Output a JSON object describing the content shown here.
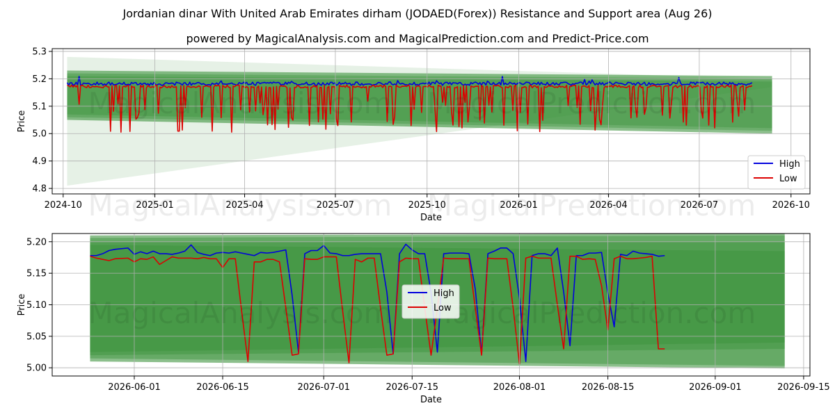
{
  "title": "Jordanian dinar With United Arab Emirates dirham (JODAED(Forex)) Resistance and Support area (Aug 26)",
  "subtitle": "powered by MagicalAnalysis.com and MagicalPrediction.com and Predict-Price.com",
  "watermarks": [
    "MagicalAnalysis.com",
    "MagicalPrediction.com"
  ],
  "colors": {
    "high": "#0000dd",
    "low": "#dd0000",
    "band": "#2e8b2e",
    "grid": "#b0b0b0"
  },
  "chart_data": [
    {
      "type": "line",
      "xlabel": "Date",
      "ylabel": "Price",
      "x_ticks": [
        "2024-10",
        "2025-01",
        "2025-04",
        "2025-07",
        "2025-10",
        "2026-01",
        "2026-04",
        "2026-07",
        "2026-10"
      ],
      "y_ticks": [
        "4.8",
        "4.9",
        "5.0",
        "5.1",
        "5.2",
        "5.3"
      ],
      "x_range": [
        "2024-09-20",
        "2026-10-20"
      ],
      "ylim": [
        4.78,
        5.31
      ],
      "x_start": "2024-10-05",
      "x_end": "2026-08-24",
      "band_end": "2026-09-12",
      "bands": [
        {
          "start": [
            4.81,
            5.28
          ],
          "end": [
            5.17,
            5.2
          ],
          "opacity": 0.12
        },
        {
          "start": [
            5.05,
            5.23
          ],
          "end": [
            5.0,
            5.21
          ],
          "opacity": 0.55
        },
        {
          "start": [
            5.06,
            5.22
          ],
          "end": [
            5.01,
            5.2
          ],
          "opacity": 0.35
        },
        {
          "start": [
            5.07,
            5.21
          ],
          "end": [
            5.02,
            5.19
          ],
          "opacity": 0.3
        }
      ],
      "series": [
        {
          "name": "High",
          "base": 5.182,
          "amp": 0.006,
          "spike": 5.205
        },
        {
          "name": "Low",
          "base": 5.172,
          "dip_min": 5.005,
          "dip_max": 5.12,
          "spike": 5.212
        }
      ],
      "legend": {
        "position": "lower-right",
        "entries": [
          "High",
          "Low"
        ]
      },
      "grid": true
    },
    {
      "type": "line",
      "xlabel": "Date",
      "ylabel": "Price",
      "x_ticks": [
        "2026-06-01",
        "2026-06-15",
        "2026-07-01",
        "2026-07-15",
        "2026-08-01",
        "2026-08-15",
        "2026-09-01",
        "2026-09-15"
      ],
      "y_ticks": [
        "5.00",
        "5.05",
        "5.10",
        "5.15",
        "5.20"
      ],
      "x_range": [
        "2026-05-19",
        "2026-09-16"
      ],
      "ylim": [
        4.987,
        5.213
      ],
      "band_start": "2026-05-25",
      "band_end": "2026-09-12",
      "bands": [
        {
          "start": [
            5.01,
            5.21
          ],
          "end": [
            4.999,
            5.213
          ],
          "opacity": 0.55
        },
        {
          "start": [
            5.015,
            5.206
          ],
          "end": [
            5.003,
            5.21
          ],
          "opacity": 0.4
        },
        {
          "start": [
            5.02,
            5.2
          ],
          "end": [
            5.03,
            5.2
          ],
          "opacity": 0.35
        },
        {
          "start": [
            5.025,
            5.195
          ],
          "end": [
            5.04,
            5.185
          ],
          "opacity": 0.3
        }
      ],
      "series": [
        {
          "name": "High",
          "x": [
            "2026-05-25",
            "2026-05-26",
            "2026-05-27",
            "2026-05-28",
            "2026-05-29",
            "2026-05-31",
            "2026-06-01",
            "2026-06-02",
            "2026-06-03",
            "2026-06-04",
            "2026-06-05",
            "2026-06-06",
            "2026-06-07",
            "2026-06-08",
            "2026-06-09",
            "2026-06-10",
            "2026-06-11",
            "2026-06-12",
            "2026-06-13",
            "2026-06-14",
            "2026-06-15",
            "2026-06-16",
            "2026-06-17",
            "2026-06-18",
            "2026-06-19",
            "2026-06-20",
            "2026-06-21",
            "2026-06-22",
            "2026-06-23",
            "2026-06-24",
            "2026-06-25",
            "2026-06-26",
            "2026-06-27",
            "2026-06-28",
            "2026-06-29",
            "2026-06-30",
            "2026-07-01",
            "2026-07-02",
            "2026-07-03",
            "2026-07-04",
            "2026-07-05",
            "2026-07-06",
            "2026-07-07",
            "2026-07-08",
            "2026-07-09",
            "2026-07-10",
            "2026-07-11",
            "2026-07-12",
            "2026-07-13",
            "2026-07-14",
            "2026-07-15",
            "2026-07-16",
            "2026-07-17",
            "2026-07-18",
            "2026-07-19",
            "2026-07-20",
            "2026-07-21",
            "2026-07-22",
            "2026-07-23",
            "2026-07-24",
            "2026-07-25",
            "2026-07-26",
            "2026-07-27",
            "2026-07-28",
            "2026-07-29",
            "2026-07-30",
            "2026-07-31",
            "2026-08-01",
            "2026-08-02",
            "2026-08-03",
            "2026-08-04",
            "2026-08-05",
            "2026-08-06",
            "2026-08-07",
            "2026-08-08",
            "2026-08-09",
            "2026-08-10",
            "2026-08-11",
            "2026-08-12",
            "2026-08-13",
            "2026-08-14",
            "2026-08-15",
            "2026-08-16",
            "2026-08-17",
            "2026-08-18",
            "2026-08-19",
            "2026-08-20",
            "2026-08-21",
            "2026-08-22",
            "2026-08-23",
            "2026-08-24"
          ],
          "values": [
            5.178,
            5.178,
            5.181,
            5.186,
            5.188,
            5.19,
            5.18,
            5.184,
            5.181,
            5.185,
            5.181,
            5.181,
            5.18,
            5.182,
            5.185,
            5.195,
            5.183,
            5.18,
            5.178,
            5.182,
            5.183,
            5.182,
            5.184,
            5.182,
            5.18,
            5.178,
            5.183,
            5.182,
            5.183,
            5.185,
            5.187,
            5.115,
            5.025,
            5.181,
            5.186,
            5.186,
            5.194,
            5.182,
            5.181,
            5.178,
            5.178,
            5.18,
            5.181,
            5.181,
            5.181,
            5.181,
            5.12,
            5.022,
            5.181,
            5.196,
            5.187,
            5.181,
            5.181,
            5.119,
            5.025,
            5.181,
            5.182,
            5.182,
            5.182,
            5.181,
            5.125,
            5.022,
            5.181,
            5.185,
            5.19,
            5.19,
            5.181,
            5.11,
            5.01,
            5.178,
            5.181,
            5.181,
            5.178,
            5.19,
            5.12,
            5.035,
            5.178,
            5.178,
            5.182,
            5.182,
            5.183,
            5.118,
            5.065,
            5.18,
            5.178,
            5.185,
            5.182,
            5.181,
            5.18,
            5.177,
            5.178
          ],
          "color": "#0000dd"
        },
        {
          "name": "Low",
          "x": [
            "2026-05-25",
            "2026-05-26",
            "2026-05-27",
            "2026-05-28",
            "2026-05-29",
            "2026-05-31",
            "2026-06-01",
            "2026-06-02",
            "2026-06-03",
            "2026-06-04",
            "2026-06-05",
            "2026-06-06",
            "2026-06-07",
            "2026-06-08",
            "2026-06-09",
            "2026-06-10",
            "2026-06-11",
            "2026-06-12",
            "2026-06-13",
            "2026-06-14",
            "2026-06-15",
            "2026-06-16",
            "2026-06-17",
            "2026-06-18",
            "2026-06-19",
            "2026-06-20",
            "2026-06-21",
            "2026-06-22",
            "2026-06-23",
            "2026-06-24",
            "2026-06-25",
            "2026-06-26",
            "2026-06-27",
            "2026-06-28",
            "2026-06-29",
            "2026-06-30",
            "2026-07-01",
            "2026-07-02",
            "2026-07-03",
            "2026-07-04",
            "2026-07-05",
            "2026-07-06",
            "2026-07-07",
            "2026-07-08",
            "2026-07-09",
            "2026-07-10",
            "2026-07-11",
            "2026-07-12",
            "2026-07-13",
            "2026-07-14",
            "2026-07-15",
            "2026-07-16",
            "2026-07-17",
            "2026-07-18",
            "2026-07-19",
            "2026-07-20",
            "2026-07-21",
            "2026-07-22",
            "2026-07-23",
            "2026-07-24",
            "2026-07-25",
            "2026-07-26",
            "2026-07-27",
            "2026-07-28",
            "2026-07-29",
            "2026-07-30",
            "2026-07-31",
            "2026-08-01",
            "2026-08-02",
            "2026-08-03",
            "2026-08-04",
            "2026-08-05",
            "2026-08-06",
            "2026-08-07",
            "2026-08-08",
            "2026-08-09",
            "2026-08-10",
            "2026-08-11",
            "2026-08-12",
            "2026-08-13",
            "2026-08-14",
            "2026-08-15",
            "2026-08-16",
            "2026-08-17",
            "2026-08-18",
            "2026-08-19",
            "2026-08-20",
            "2026-08-21",
            "2026-08-22",
            "2026-08-23",
            "2026-08-24"
          ],
          "values": [
            5.177,
            5.174,
            5.172,
            5.17,
            5.173,
            5.174,
            5.168,
            5.173,
            5.172,
            5.176,
            5.164,
            5.17,
            5.176,
            5.174,
            5.174,
            5.174,
            5.173,
            5.175,
            5.173,
            5.173,
            5.159,
            5.173,
            5.173,
            5.09,
            5.01,
            5.168,
            5.168,
            5.172,
            5.172,
            5.168,
            5.095,
            5.02,
            5.022,
            5.173,
            5.172,
            5.172,
            5.176,
            5.176,
            5.176,
            5.09,
            5.008,
            5.172,
            5.168,
            5.174,
            5.174,
            5.095,
            5.02,
            5.022,
            5.168,
            5.174,
            5.173,
            5.173,
            5.095,
            5.02,
            5.095,
            5.174,
            5.173,
            5.173,
            5.173,
            5.173,
            5.095,
            5.02,
            5.174,
            5.173,
            5.173,
            5.173,
            5.095,
            5.006,
            5.174,
            5.177,
            5.174,
            5.174,
            5.174,
            5.1,
            5.03,
            5.177,
            5.177,
            5.172,
            5.173,
            5.172,
            5.13,
            5.06,
            5.173,
            5.177,
            5.173,
            5.173,
            5.174,
            5.175,
            5.177,
            5.03,
            5.03
          ],
          "color": "#dd0000"
        }
      ],
      "legend": {
        "position": "center",
        "entries": [
          "High",
          "Low"
        ]
      },
      "grid": true
    }
  ]
}
